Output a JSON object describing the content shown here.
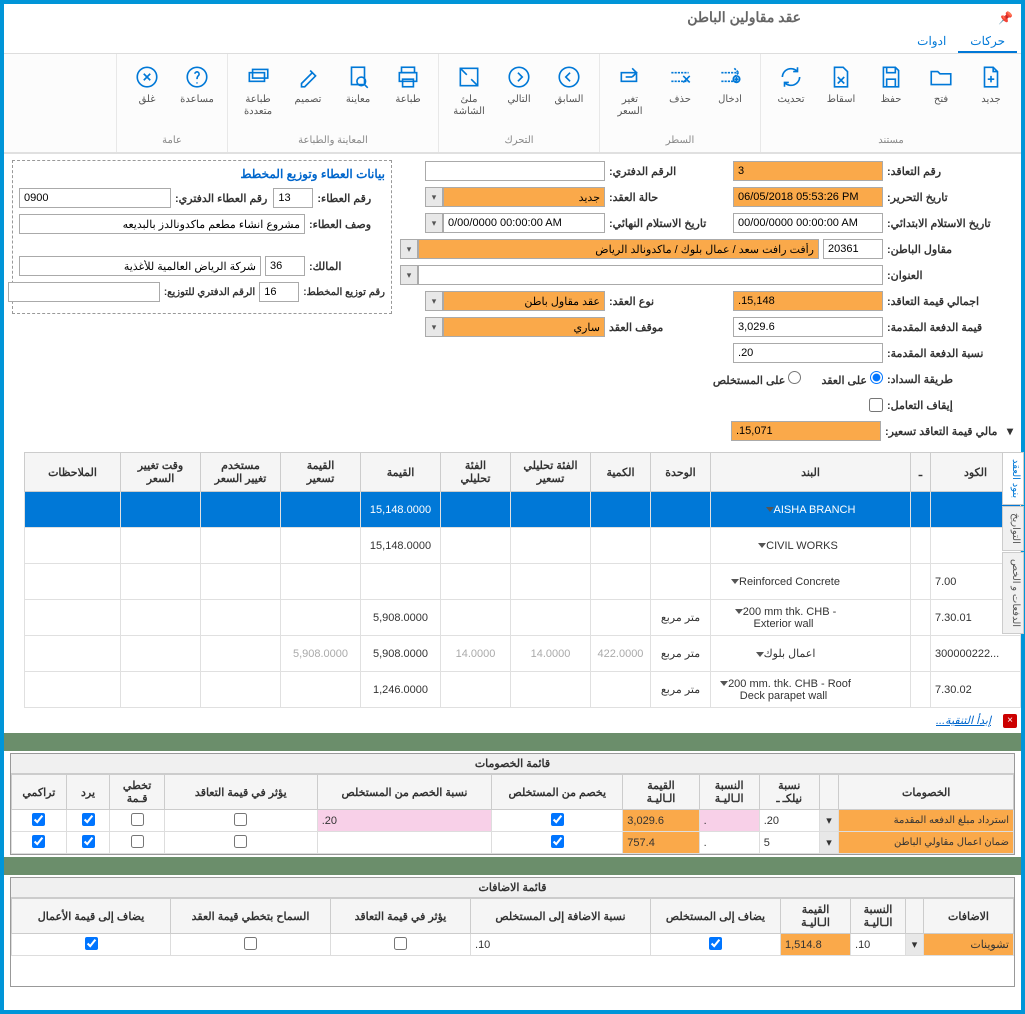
{
  "title": "عقد مقاولين الباطن",
  "tabs": {
    "t1": "حركات",
    "t2": "ادوات"
  },
  "ribbon": {
    "doc_group": "مستند",
    "doc": {
      "new": "جديد",
      "open": "فتح",
      "save": "حفظ",
      "drop": "اسقاط",
      "refresh": "تحديث"
    },
    "line_group": "السطر",
    "line": {
      "insert": "ادخال",
      "delete": "حذف",
      "reprice": "تغير\nالسعر"
    },
    "nav_group": "التحرك",
    "nav": {
      "prev": "السابق",
      "next": "التالي",
      "full": "ملئ\nالشاشة"
    },
    "print_group": "المعاينة والطباعة",
    "print": {
      "print": "طباعة",
      "preview": "معاينة",
      "design": "تصميم",
      "multi": "طباعة\nمتعددة"
    },
    "gen_group": "عامة",
    "gen": {
      "help": "مساعدة",
      "close": "غلق"
    }
  },
  "form": {
    "contract_no_lbl": "رقم التعاقد:",
    "contract_no": "3",
    "book_no_lbl": "الرقم الدفتري:",
    "book_no": "",
    "edit_date_lbl": "تاريخ التحرير:",
    "edit_date": "06/05/2018 05:53:26 PM",
    "status_lbl": "حالة العقد:",
    "status": "جديد",
    "init_recv_lbl": "تاريخ الاستلام الابتدائي:",
    "init_recv": "00/00/0000 00:00:00 AM",
    "final_recv_lbl": "تاريخ الاستلام النهائي:",
    "final_recv": "0/00/0000 00:00:00 AM",
    "subcon_lbl": "مقاول الباطن:",
    "subcon_code": "20361",
    "subcon_name": "رأفت رافت سعد / عمال بلوك / ماكدونالد الرياض",
    "address_lbl": "العنوان:",
    "address": "",
    "total_lbl": "اجمالي قيمة التعاقد:",
    "total": "15,148.",
    "type_lbl": "نوع العقد:",
    "type": "عقد مقاول باطن",
    "advance_lbl": "قيمة الدفعة المقدمة:",
    "advance": "3,029.6",
    "c_status_lbl": "موقف العقد",
    "c_status": "ساري",
    "advance_pct_lbl": "نسبة الدفعة المقدمة:",
    "advance_pct": "20.",
    "pay_method_lbl": "طريقة السداد:",
    "pay_opt1": "على العقد",
    "pay_opt2": "على المستخلص",
    "stop_lbl": "إيقاف التعامل:",
    "price_total_lbl": "مالي قيمة التعاقد تسعير:",
    "price_total": "15,071."
  },
  "bid": {
    "title": "بيانات العطاء وتوزيع المخطط",
    "bid_no_lbl": "رقم العطاء:",
    "bid_no": "13",
    "bid_book_lbl": "رقم العطاء الدفتري:",
    "bid_book": "0900",
    "desc_lbl": "وصف العطاء:",
    "desc": "مشروع انشاء مطعم ماكدونالدز بالبديعه",
    "owner_lbl": "المالك:",
    "owner_code": "36",
    "owner_name": "شركة الرياض العالمية للأغذية",
    "plan_lbl": "رقم توزيع المخطط:",
    "plan": "16",
    "plan_book_lbl": "الرقم الدفتري للتوزيع:",
    "plan_book": ""
  },
  "grid": {
    "h": {
      "code": "الكود",
      "expand": "ـ",
      "item": "البند",
      "unit": "الوحدة",
      "qty": "الكمية",
      "anal": "الفئة تحليلي\nتسعير",
      "anal2": "الفئة\nتحليلي",
      "val": "القيمة",
      "pval": "القيمة\nتسعير",
      "usr": "مستخدم\nتغيير السعر",
      "time": "وقت تغيير\nالسعر",
      "notes": "الملاحظات"
    },
    "rows": [
      {
        "code": "",
        "item": "AISHA BRANCH",
        "val": "15,148.0000",
        "sel": true,
        "indent": 0
      },
      {
        "code": "",
        "item": "CIVIL WORKS",
        "val": "15,148.0000",
        "indent": 1
      },
      {
        "code": "7.00",
        "item": "Reinforced Concrete",
        "val": "",
        "indent": 2
      },
      {
        "code": "7.30.01",
        "item": "200 mm thk. CHB - Exterior wall",
        "unit": "متر مربع",
        "val": "5,908.0000",
        "indent": 2
      },
      {
        "code": "300000222...",
        "item": "اعمال بلوك",
        "unit": "متر مربع",
        "qty": "422.0000",
        "anal": "14.0000",
        "anal2": "14.0000",
        "val": "5,908.0000",
        "pval": "5,908.0000",
        "indent": 2,
        "gray": true
      },
      {
        "code": "7.30.02",
        "item": "200 mm. thk. CHB - Roof Deck parapet wall",
        "unit": "متر مربع",
        "val": "1,246.0000",
        "indent": 2
      }
    ],
    "filter": "إبدأ التنقية...",
    "stabs": {
      "items": "بنود العقد",
      "dates": "التواريخ",
      "pay": "الدفعات و الخص"
    }
  },
  "disc": {
    "title": "قائمة الخصومات",
    "h": {
      "name": "الخصومات",
      "npct": "نسبة\nنيلكـ ـ",
      "cpct": "النسبة\nالـاليـة",
      "cval": "القيمة\nالـاليـة",
      "fromext": "يخصم من المستخلص",
      "extpct": "نسبة الخصم من المستخلص",
      "affect": "يؤثر في قيمة التعاقد",
      "skip": "تخطي\nقـمة",
      "refund": "يرد",
      "cum": "تراكمي"
    },
    "rows": [
      {
        "name": "استرداد مبلغ الدفعه المقدمة",
        "npct": "20.",
        "cpct": ".",
        "cval": "3,029.6",
        "fromext": true,
        "extpct": "20.",
        "affect": false,
        "skip": false,
        "refund": true,
        "cum": true,
        "pink": true
      },
      {
        "name": "ضمان اعمال مقاولي الباطن",
        "npct": "5",
        "cpct": ".",
        "cval": "757.4",
        "fromext": true,
        "extpct": "",
        "affect": false,
        "skip": false,
        "refund": true,
        "cum": true
      }
    ]
  },
  "add": {
    "title": "قائمة الاضافات",
    "h": {
      "name": "الاضافات",
      "cpct": "النسبة\nالـاليـة",
      "cval": "القيمة\nالـاليـة",
      "toext": "يضاف إلى المستخلص",
      "extpct": "نسبة الاضافة إلى المستخلص",
      "affect": "يؤثر في قيمة التعاقد",
      "exceed": "السماح بتخطي قيمة العقد",
      "towork": "يضاف إلى قيمة الأعمال"
    },
    "rows": [
      {
        "name": "تشوينات",
        "cpct": "10.",
        "cval": "1,514.8",
        "toext": true,
        "extpct": "10.",
        "affect": false,
        "exceed": false,
        "towork": true
      }
    ]
  }
}
